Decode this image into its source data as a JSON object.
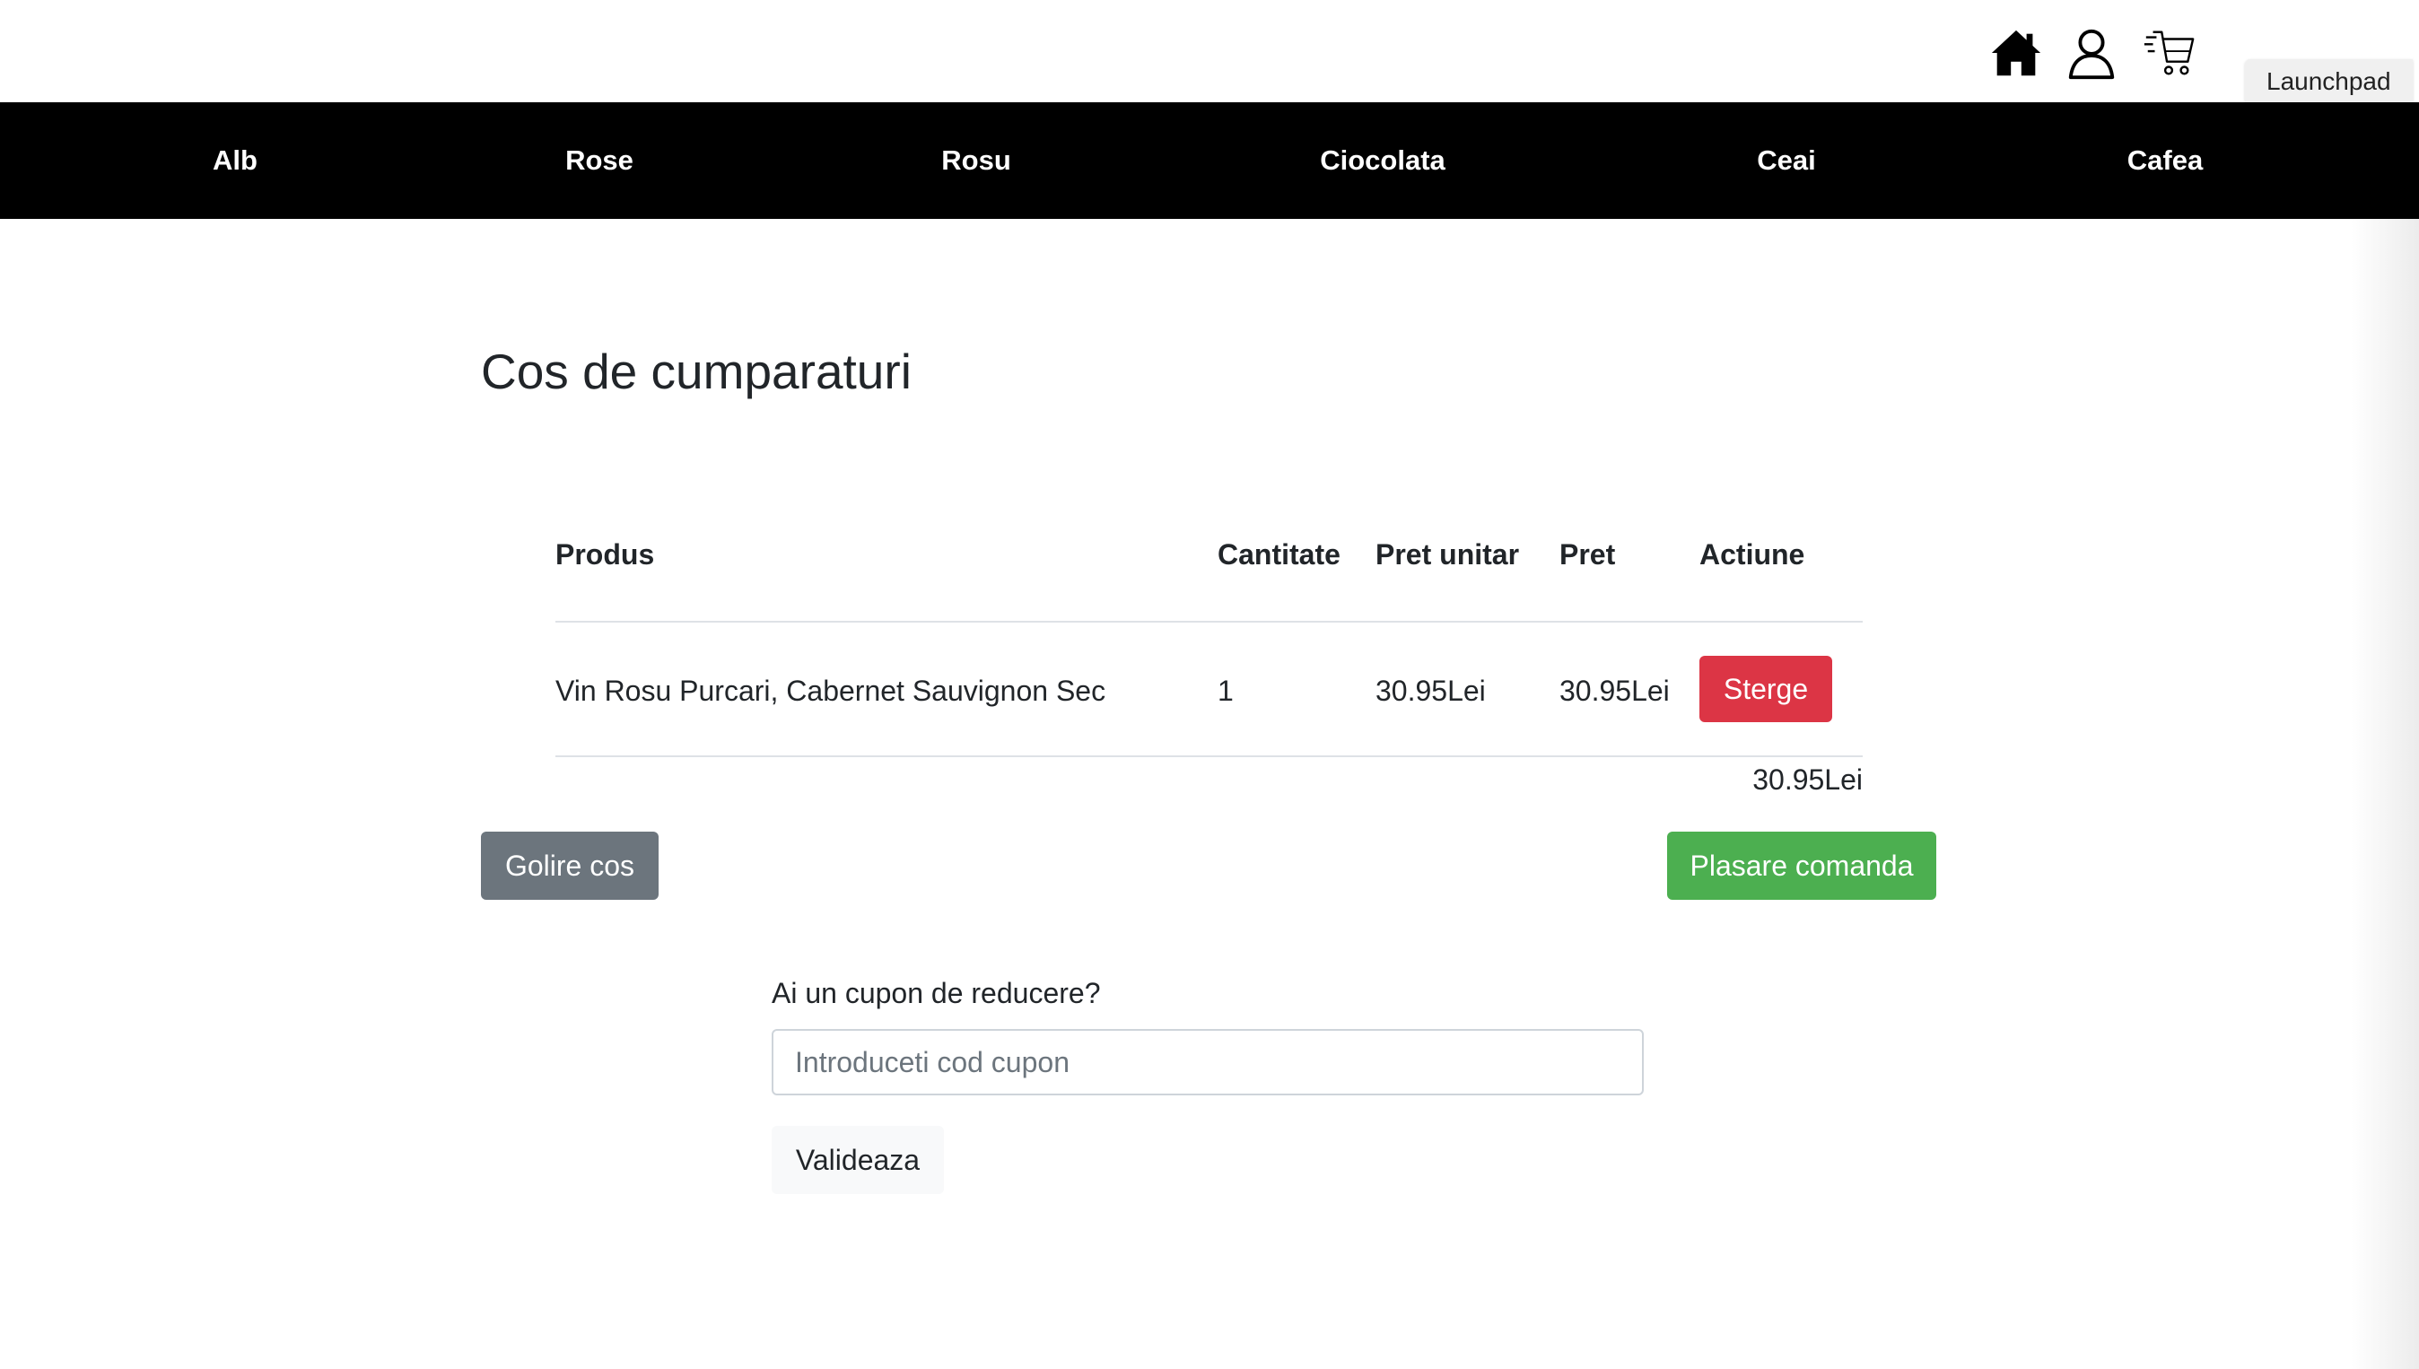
{
  "header": {
    "icons": [
      "home-icon",
      "user-icon",
      "cart-icon"
    ],
    "launchpad_label": "Launchpad"
  },
  "nav": {
    "items": [
      "Alb",
      "Rose",
      "Rosu",
      "Ciocolata",
      "Ceai",
      "Cafea"
    ]
  },
  "cart": {
    "title": "Cos de cumparaturi",
    "columns": {
      "product": "Produs",
      "quantity": "Cantitate",
      "unit_price": "Pret unitar",
      "price": "Pret",
      "action": "Actiune"
    },
    "rows": [
      {
        "product": "Vin Rosu Purcari, Cabernet Sauvignon Sec",
        "quantity": "1",
        "unit_price": "30.95Lei",
        "price": "30.95Lei",
        "action_label": "Sterge"
      }
    ],
    "total": "30.95Lei",
    "clear_label": "Golire cos",
    "checkout_label": "Plasare comanda"
  },
  "coupon": {
    "label": "Ai un cupon de reducere?",
    "placeholder": "Introduceti cod cupon",
    "value": "",
    "validate_label": "Valideaza"
  },
  "colors": {
    "nav_bg": "#000000",
    "danger": "#dc3545",
    "secondary": "#6c757d",
    "success": "#4caf50"
  }
}
